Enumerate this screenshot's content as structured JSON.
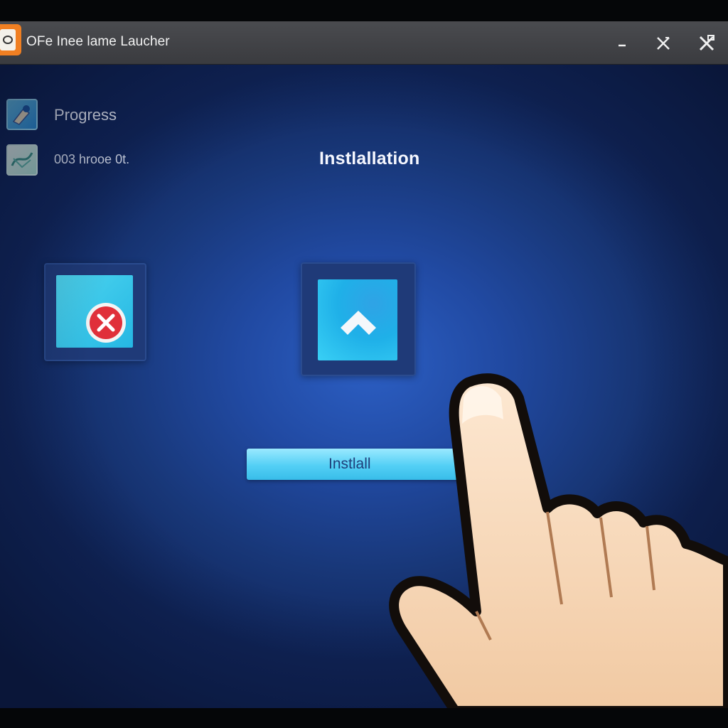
{
  "window": {
    "title": "OFe Inee lame Laucher",
    "controls": {
      "minimize_icon": "minimize-icon",
      "restore_icon": "restore-icon",
      "close_icon": "close-icon"
    }
  },
  "sidebar": {
    "items": [
      {
        "label": "Progress",
        "icon": "progress-icon"
      },
      {
        "label": "003 hrooe 0t.",
        "icon": "status-icon"
      }
    ]
  },
  "main": {
    "heading": "Instlallation",
    "tiles": [
      {
        "icon": "cancel-x-icon"
      },
      {
        "icon": "arrow-up-icon"
      }
    ],
    "install_button_label": "Instlall"
  },
  "colors": {
    "accent": "#3bc6ef",
    "background": "#1f45a0",
    "titlebar": "#434448",
    "cancel_red": "#e0303a"
  }
}
